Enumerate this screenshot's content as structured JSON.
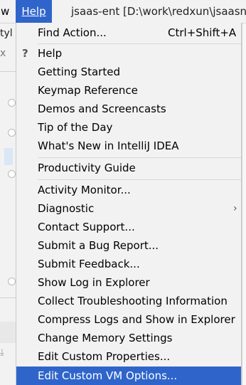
{
  "menubar": {
    "view_fragment": "w",
    "help_label": "Help",
    "title_fragment": "jsaas-ent [D:\\work\\redxun\\jsaasne"
  },
  "ide": {
    "frag_1": "tyl",
    "frag_2": "x"
  },
  "menu": {
    "items": [
      {
        "label": "Find Action...",
        "shortcut": "Ctrl+Shift+A"
      },
      {
        "label": "Help",
        "mark": "?"
      },
      {
        "label": "Getting Started"
      },
      {
        "label": "Keymap Reference"
      },
      {
        "label": "Demos and Screencasts"
      },
      {
        "label": "Tip of the Day"
      },
      {
        "label": "What's New in IntelliJ IDEA"
      },
      {
        "label": "Productivity Guide"
      },
      {
        "label": "Activity Monitor..."
      },
      {
        "label": "Diagnostic",
        "arrow": "›"
      },
      {
        "label": "Contact Support..."
      },
      {
        "label": "Submit a Bug Report..."
      },
      {
        "label": "Submit Feedback..."
      },
      {
        "label": "Show Log in Explorer"
      },
      {
        "label": "Collect Troubleshooting Information"
      },
      {
        "label": "Compress Logs and Show in Explorer"
      },
      {
        "label": "Change Memory Settings"
      },
      {
        "label": "Edit Custom Properties..."
      },
      {
        "label": "Edit Custom VM Options..."
      }
    ]
  }
}
